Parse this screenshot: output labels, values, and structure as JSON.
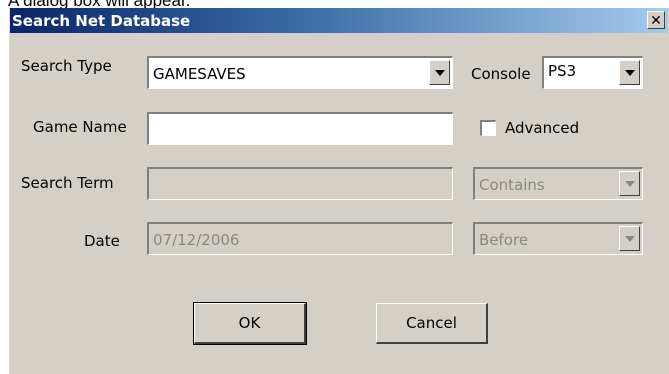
{
  "caption": "A dialog box will appear.",
  "dialog": {
    "title": "Search Net Database",
    "close_glyph": "✕",
    "search_type": {
      "label": "Search Type",
      "value": "GAMESAVES"
    },
    "console": {
      "label": "Console",
      "value": "PS3"
    },
    "game_name": {
      "label": "Game Name",
      "value": ""
    },
    "advanced": {
      "label": "Advanced",
      "checked": false
    },
    "search_term": {
      "label": "Search Term",
      "value": "",
      "enabled": false
    },
    "match_mode": {
      "value": "Contains",
      "enabled": false
    },
    "date": {
      "label": "Date",
      "value": "07/12/2006",
      "enabled": false
    },
    "date_mode": {
      "value": "Before",
      "enabled": false
    },
    "buttons": {
      "ok": "OK",
      "cancel": "Cancel"
    }
  },
  "colors": {
    "titlebar_start": "#0a246a",
    "titlebar_end": "#a6caf0",
    "dialog_face": "#d4d0c8",
    "disabled_text": "#8a877f"
  },
  "icons": [
    "close-icon",
    "dropdown-arrow-icon"
  ]
}
